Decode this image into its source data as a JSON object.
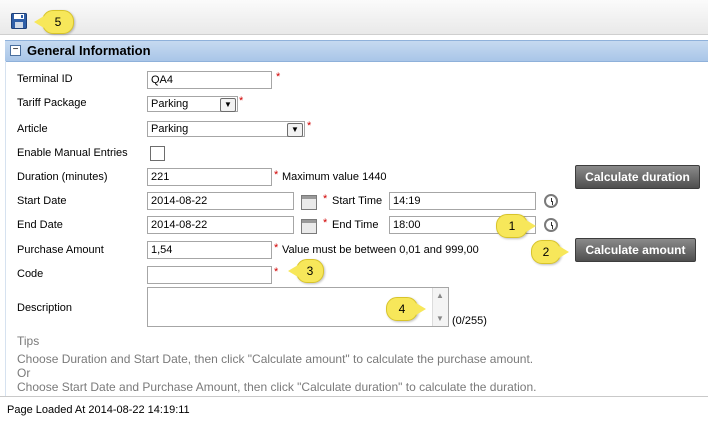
{
  "toolbar": {
    "save_icon": "save-icon",
    "callout_5": "5"
  },
  "section": {
    "title": "General Information",
    "collapse": "−"
  },
  "form": {
    "terminal_id": {
      "label": "Terminal ID",
      "value": "QA4"
    },
    "tariff_package": {
      "label": "Tariff Package",
      "value": "Parking"
    },
    "article": {
      "label": "Article",
      "value": "Parking"
    },
    "enable_manual": {
      "label": "Enable Manual Entries",
      "checked": false
    },
    "duration": {
      "label": "Duration (minutes)",
      "value": "221",
      "note": "Maximum value 1440"
    },
    "start_date": {
      "label": "Start Date",
      "value": "2014-08-22"
    },
    "start_time": {
      "label": "Start Time",
      "value": "14:19"
    },
    "end_date": {
      "label": "End Date",
      "value": "2014-08-22"
    },
    "end_time": {
      "label": "End Time",
      "value": "18:00"
    },
    "purchase_amount": {
      "label": "Purchase Amount",
      "value": "1,54",
      "note": "Value must be between 0,01 and 999,00"
    },
    "code": {
      "label": "Code",
      "value": ""
    },
    "description": {
      "label": "Description",
      "value": "",
      "counter": "(0/255)"
    },
    "required_mark": "*"
  },
  "buttons": {
    "calc_duration": "Calculate duration",
    "calc_amount": "Calculate amount"
  },
  "callouts": {
    "c1": "1",
    "c2": "2",
    "c3": "3",
    "c4": "4"
  },
  "tips": {
    "title": "Tips",
    "line1": "Choose Duration and Start Date, then click \"Calculate amount\" to calculate the purchase amount.",
    "line2": "Or",
    "line3": "Choose Start Date and Purchase Amount, then click \"Calculate duration\" to calculate the duration."
  },
  "footer": {
    "loaded": "Page Loaded At 2014-08-22 14:19:11"
  },
  "colors": {
    "header_blue": "#a9c6e8",
    "required_red": "#d00000",
    "callout_yellow": "#f7e75a"
  }
}
